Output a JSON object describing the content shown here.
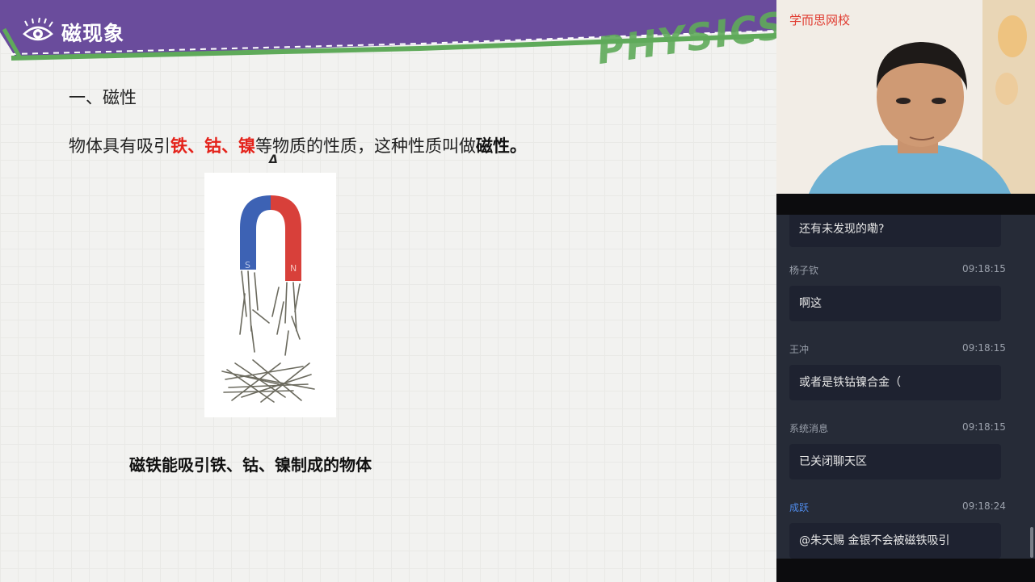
{
  "slide": {
    "title": "磁现象",
    "watermark": "PHYSICS",
    "section_heading": "一、磁性",
    "definition": {
      "prefix": "物体具有吸引",
      "iron": "铁",
      "sep1": "、",
      "cobalt": "钴",
      "sep2": "、",
      "nickel": "镍",
      "middle": "等物质的性质，这种性质叫做",
      "term": "磁性",
      "end": "。"
    },
    "delta_mark": "Δ",
    "magnet_labels": {
      "south": "S",
      "north": "N"
    },
    "caption": "磁铁能吸引铁、钴、镍制成的物体"
  },
  "sidebar": {
    "brand": "学而思网校",
    "messages": [
      {
        "name": "",
        "time": "",
        "text": "还有未发现的嘞?"
      },
      {
        "name": "杨子钦",
        "time": "09:18:15",
        "text": "啊这"
      },
      {
        "name": "王冲",
        "time": "09:18:15",
        "text": "或者是铁钴镍合金（"
      },
      {
        "name": "系统消息",
        "time": "09:18:15",
        "text": "已关闭聊天区"
      },
      {
        "name": "成跃",
        "time": "09:18:24",
        "text": "@朱天赐 金银不会被磁铁吸引"
      }
    ]
  },
  "colors": {
    "header_purple": "#6a4c9c",
    "header_green": "#5faa5a",
    "highlight_red": "#e4231b",
    "magnet_blue": "#3d62b4",
    "magnet_red": "#d8403a",
    "chat_bg": "#262b37",
    "bubble_bg": "#1e2230"
  },
  "icons": [
    "eye-icon",
    "physics-watermark",
    "person-video"
  ]
}
